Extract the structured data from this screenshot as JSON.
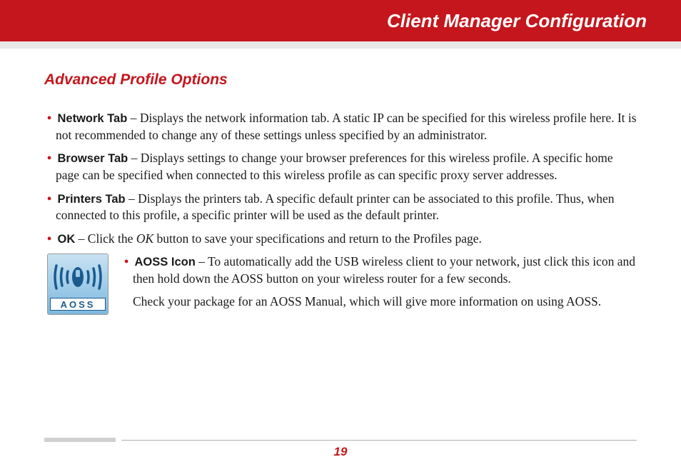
{
  "header": {
    "title": "Client Manager Configuration"
  },
  "subtitle": "Advanced Profile Options",
  "bullets": [
    {
      "label": "Network Tab",
      "text": " –  Displays the network information tab.  A static IP can be specified for this wireless profile here.  It is not recommended to change any of these settings unless specified by an administrator."
    },
    {
      "label": "Browser Tab",
      "text": " –  Displays settings to change your browser preferences for this wireless profile.  A specific home page can be specified when connected to this wireless profile as can specific proxy server addresses."
    },
    {
      "label": "Printers Tab",
      "text": " –  Displays the printers tab.  A specific default printer can be associated to this profile.  Thus, when connected to this profile, a specific printer will be used as the default printer."
    }
  ],
  "ok_bullet": {
    "label": "OK",
    "prefix": " – Click the ",
    "italic": "OK",
    "suffix": " button to save your specifications and return to the Profiles page."
  },
  "aoss": {
    "label": "AOSS Icon",
    "text": " –  To automatically add the USB wireless client to your network, just click this icon and then hold down the AOSS button on your wireless router for a few seconds.",
    "follow": "Check your package for an AOSS Manual, which will give more information on using AOSS.",
    "icon_label": "AOSS"
  },
  "page_number": "19"
}
